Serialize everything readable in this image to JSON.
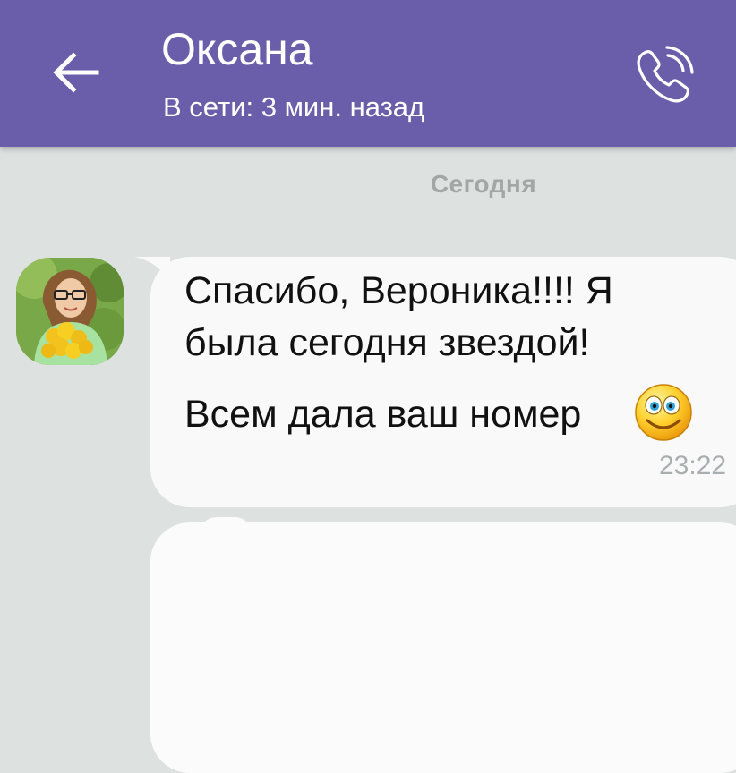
{
  "header": {
    "contact_name": "Оксана",
    "status": "В сети: 3 мин. назад",
    "back_icon": "arrow-left-icon",
    "call_icon": "phone-icon",
    "background_color": "#6a5eab"
  },
  "chat": {
    "date_divider": "Сегодня",
    "background_color": "#dde1e0",
    "messages": [
      {
        "lines": [
          "Спасибо, Вероника!!!! Я",
          "была сегодня звездой!",
          "Всем дала ваш номер"
        ],
        "emoji": "smiley-face-emoji",
        "time": "23:22"
      }
    ]
  }
}
